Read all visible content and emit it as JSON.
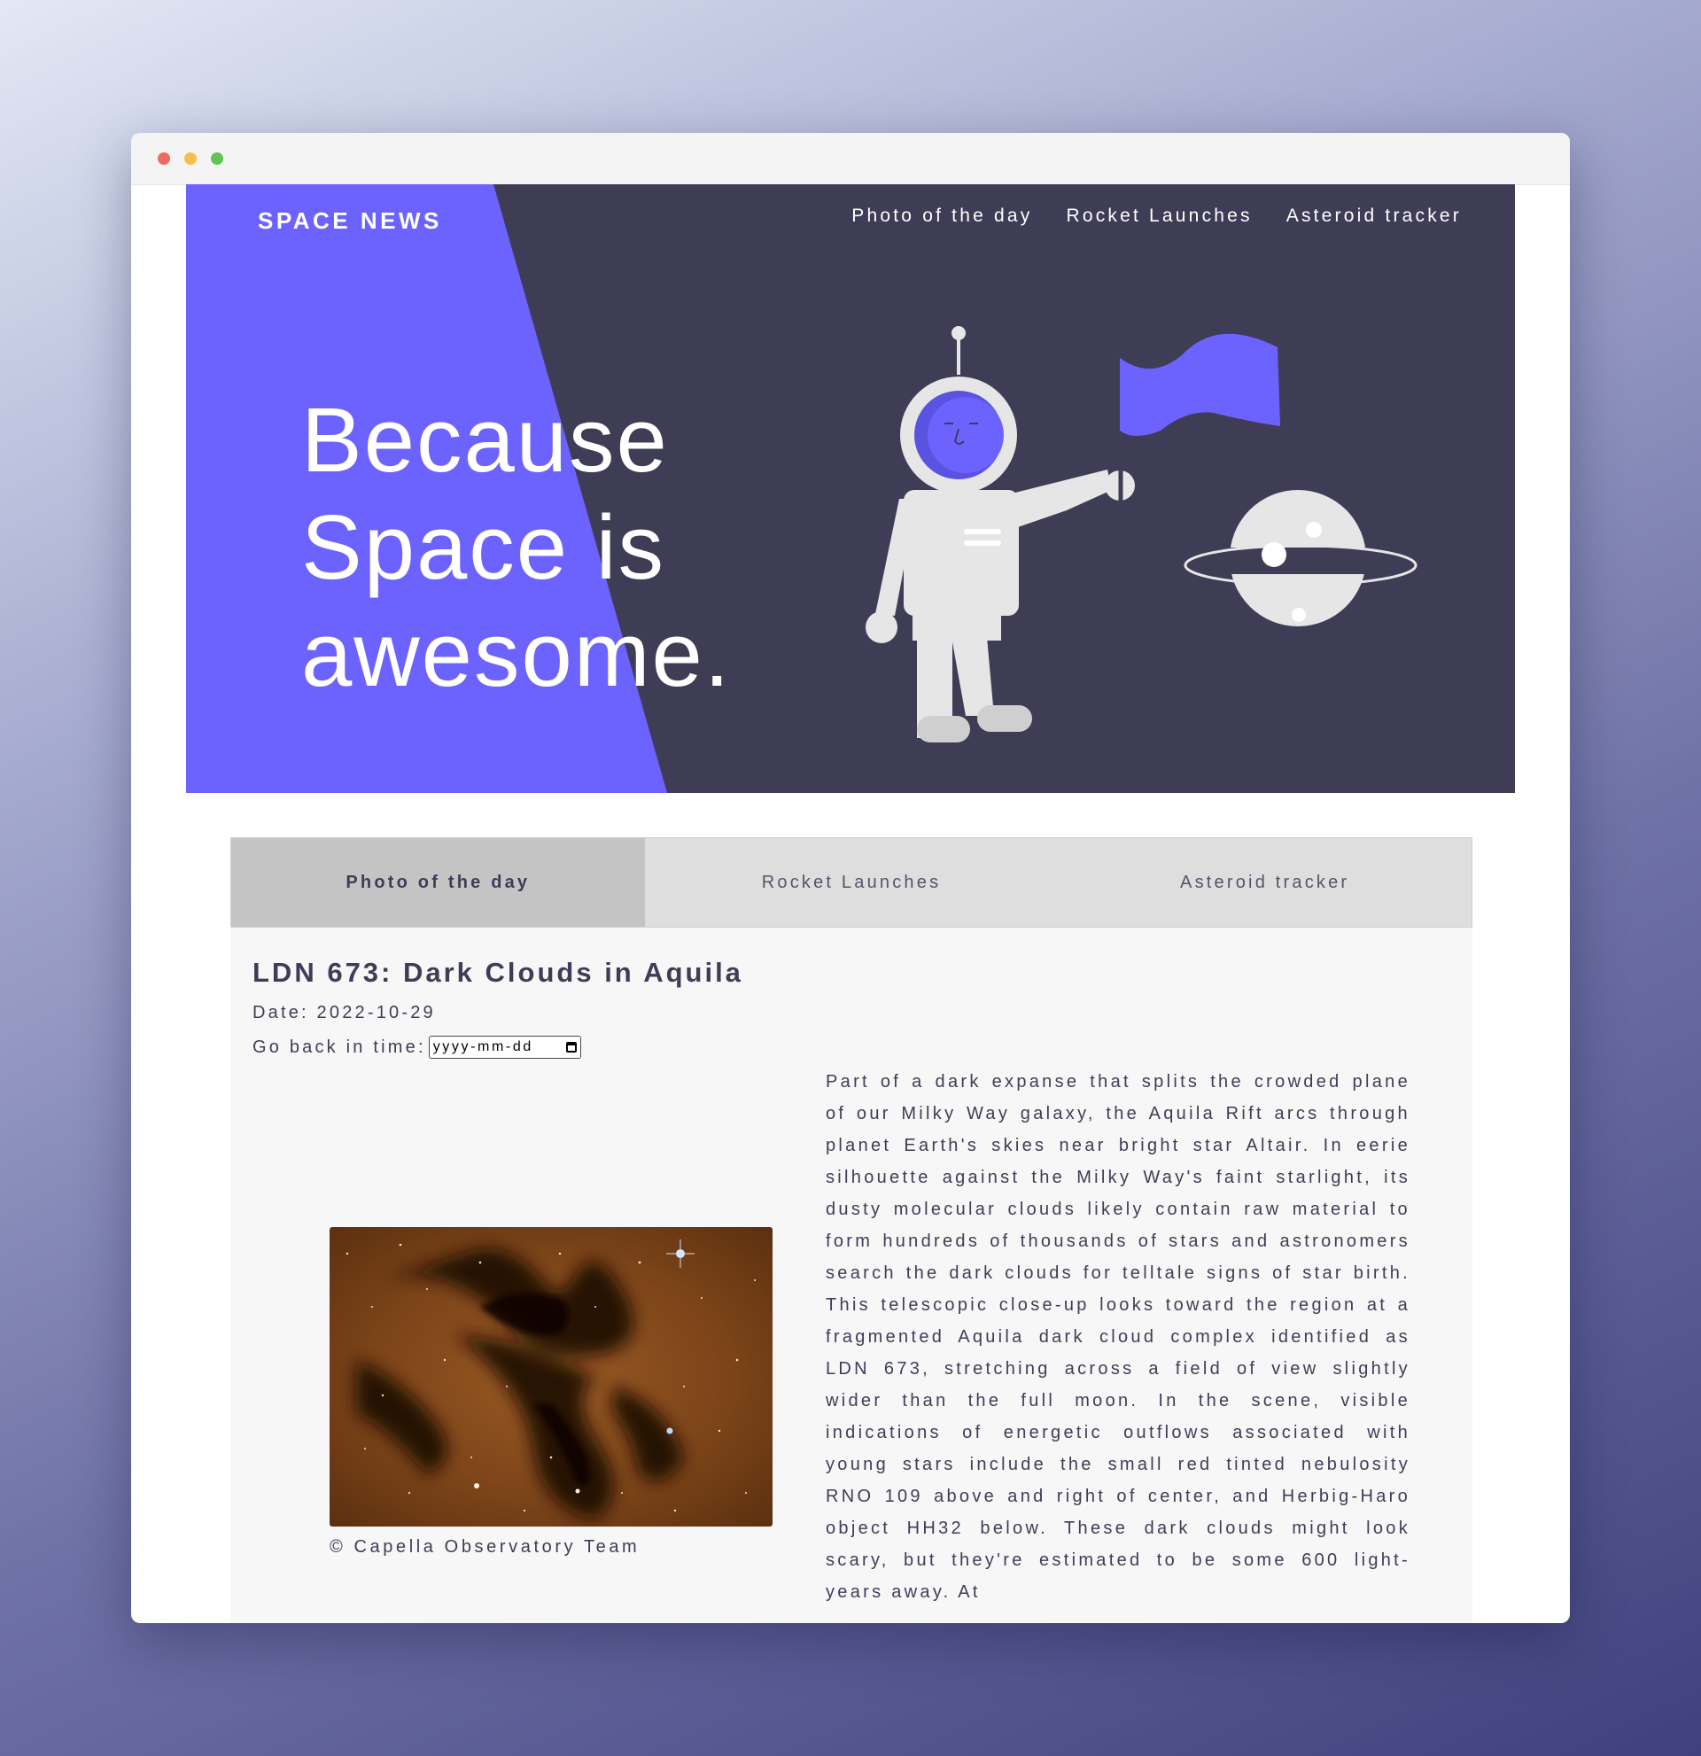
{
  "window": {
    "controls": [
      "close",
      "minimize",
      "maximize"
    ]
  },
  "header": {
    "brand": "SPACE NEWS",
    "nav": [
      "Photo of the day",
      "Rocket Launches",
      "Asteroid tracker"
    ]
  },
  "hero": {
    "headline_lines": [
      "Because",
      "Space is",
      "awesome."
    ],
    "illustration_icons": [
      "astronaut-icon",
      "flag-icon",
      "planet-icon"
    ]
  },
  "tabs": [
    {
      "label": "Photo of the day",
      "active": true
    },
    {
      "label": "Rocket Launches",
      "active": false
    },
    {
      "label": "Asteroid tracker",
      "active": false
    }
  ],
  "apod": {
    "title": "LDN 673: Dark Clouds in Aquila",
    "date_label": "Date: 2022-10-29",
    "goback_label": "Go back in time:",
    "date_placeholder": "yyyy-mm-dd",
    "credit": "© Capella Observatory Team",
    "explanation": "Part of a dark expanse that splits the crowded plane of our Milky Way galaxy, the Aquila Rift arcs through planet Earth's skies near bright star Altair. In eerie silhouette against the Milky Way's faint starlight, its dusty molecular clouds likely contain raw material to form hundreds of thousands of stars and astronomers search the dark clouds for telltale signs of star birth. This telescopic close-up looks toward the region at a fragmented Aquila dark cloud complex identified as LDN 673, stretching across a field of view slightly wider than the full moon. In the scene, visible indications of energetic outflows associated with young stars include the small red tinted nebulosity RNO 109 above and right of center, and Herbig-Haro object HH32 below. These dark clouds might look scary, but they're estimated to be some 600 light-years away. At"
  },
  "colors": {
    "accent": "#6c63ff",
    "dark": "#3f3d56",
    "light_gray": "#e6e6e6",
    "tab_bg": "#dedede",
    "tab_active": "#c4c4c4",
    "panel_bg": "#f7f7f7"
  }
}
